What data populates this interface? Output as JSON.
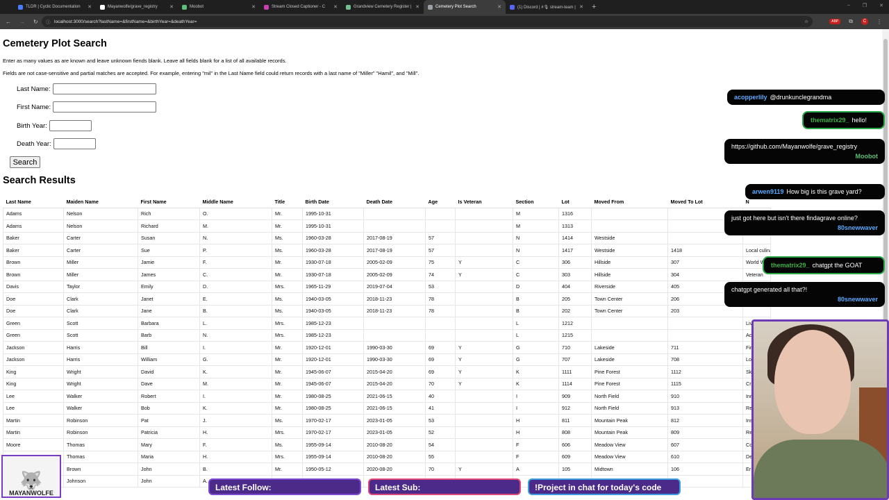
{
  "browser": {
    "tabs": [
      {
        "label": "TLDR | Cyclic Documentation",
        "color": "#4a7cff"
      },
      {
        "label": "Mayanwolfe/grave_registry",
        "color": "#ffffff"
      },
      {
        "label": "Moobot",
        "color": "#5cbf7a"
      },
      {
        "label": "Stream Closed Captioner - C",
        "color": "#c73fb0"
      },
      {
        "label": "Grandview Cemetery Register |",
        "color": "#6fbf8f"
      },
      {
        "label": "Cemetery Plot Search",
        "color": "#9aa0a6",
        "active": true
      },
      {
        "label": "(1) Discord | #🎙 stream-team |",
        "color": "#5865f2"
      }
    ],
    "new_tab": "+",
    "url": "localhost:3000/search?lastName=&firstName=&birthYear=&deathYear=",
    "ext_badge": "ABP",
    "profile_initial": "C",
    "win_controls": [
      "–",
      "❐",
      "✕"
    ]
  },
  "page": {
    "title": "Cemetery Plot Search",
    "intro1": "Enter as many values as are known and leave unknown fiends blank. Leave all fields blank for a list of all available records.",
    "intro2": "Fields are not case-sensitive and partial matches are accepted. For example, entering \"mil\" in the Last Name field could return records with a last name of \"Miller\" \"Hamil\", and \"Mill\".",
    "form": {
      "last_name_label": "Last Name:",
      "first_name_label": "First Name:",
      "birth_year_label": "Birth Year:",
      "death_year_label": "Death Year:",
      "search_label": "Search"
    },
    "results_title": "Search Results",
    "columns": [
      "Last Name",
      "Maiden Name",
      "First Name",
      "Middle Name",
      "Title",
      "Birth Date",
      "Death Date",
      "Age",
      "Is Veteran",
      "Section",
      "Lot",
      "Moved From",
      "Moved To Lot",
      "N"
    ],
    "rows": [
      [
        "Adams",
        "Nelson",
        "Rich",
        "O.",
        "Mr.",
        "1995-10-31",
        "",
        "",
        "",
        "M",
        "1316",
        "",
        "",
        ""
      ],
      [
        "Adams",
        "Nelson",
        "Richard",
        "M.",
        "Mr.",
        "1995-10-31",
        "",
        "",
        "",
        "M",
        "1313",
        "",
        "",
        ""
      ],
      [
        "Baker",
        "Carter",
        "Susan",
        "N.",
        "Ms.",
        "1960-03-28",
        "2017-08-19",
        "57",
        "",
        "N",
        "1414",
        "Westside",
        "",
        ""
      ],
      [
        "Baker",
        "Carter",
        "Sue",
        "P.",
        "Ms.",
        "1960-03-28",
        "2017-08-19",
        "57",
        "",
        "N",
        "1417",
        "Westside",
        "1418",
        "Local culinary expert"
      ],
      [
        "Brown",
        "Miller",
        "Jamie",
        "F.",
        "Mr.",
        "1930-07-18",
        "2005-02-09",
        "75",
        "Y",
        "C",
        "306",
        "Hillside",
        "307",
        "World W"
      ],
      [
        "Brown",
        "Miller",
        "James",
        "C.",
        "Mr.",
        "1930-07-18",
        "2005-02-09",
        "74",
        "Y",
        "C",
        "303",
        "Hillside",
        "304",
        "Veteran"
      ],
      [
        "Davis",
        "Taylor",
        "Emily",
        "D.",
        "Mrs.",
        "1965-11-29",
        "2019-07-04",
        "53",
        "",
        "D",
        "404",
        "Riverside",
        "405",
        ""
      ],
      [
        "Doe",
        "Clark",
        "Janet",
        "E.",
        "Ms.",
        "1940-03-05",
        "2018-11-23",
        "78",
        "",
        "B",
        "205",
        "Town Center",
        "206",
        ""
      ],
      [
        "Doe",
        "Clark",
        "Jane",
        "B.",
        "Ms.",
        "1940-03-05",
        "2018-11-23",
        "78",
        "",
        "B",
        "202",
        "Town Center",
        "203",
        ""
      ],
      [
        "Green",
        "Scott",
        "Barbara",
        "L.",
        "Mrs.",
        "1985-12-23",
        "",
        "",
        "",
        "L",
        "1212",
        "",
        "",
        "Liv"
      ],
      [
        "Green",
        "Scott",
        "Barb",
        "N.",
        "Mrs.",
        "1985-12-23",
        "",
        "",
        "",
        "L",
        "1215",
        "",
        "",
        "Ac"
      ],
      [
        "Jackson",
        "Harris",
        "Bill",
        "I.",
        "Mr.",
        "1920-12-01",
        "1990-03-30",
        "69",
        "Y",
        "G",
        "710",
        "Lakeside",
        "711",
        "Fir"
      ],
      [
        "Jackson",
        "Harris",
        "William",
        "G.",
        "Mr.",
        "1920-12-01",
        "1990-03-30",
        "69",
        "Y",
        "G",
        "707",
        "Lakeside",
        "708",
        "Lo"
      ],
      [
        "King",
        "Wright",
        "David",
        "K.",
        "Mr.",
        "1945-06-07",
        "2015-04-20",
        "69",
        "Y",
        "K",
        "1111",
        "Pine Forest",
        "1112",
        "Sk"
      ],
      [
        "King",
        "Wright",
        "Dave",
        "M.",
        "Mr.",
        "1945-06-07",
        "2015-04-20",
        "70",
        "Y",
        "K",
        "1114",
        "Pine Forest",
        "1115",
        "Cr"
      ],
      [
        "Lee",
        "Walker",
        "Robert",
        "I.",
        "Mr.",
        "1980-08-25",
        "2021-06-15",
        "40",
        "",
        "I",
        "909",
        "North Field",
        "910",
        "Inr"
      ],
      [
        "Lee",
        "Walker",
        "Bob",
        "K.",
        "Mr.",
        "1980-08-25",
        "2021-06-15",
        "41",
        "",
        "I",
        "912",
        "North Field",
        "913",
        "Re"
      ],
      [
        "Martin",
        "Robinson",
        "Pat",
        "J.",
        "Ms.",
        "1970-02-17",
        "2023-01-05",
        "53",
        "",
        "H",
        "811",
        "Mountain Peak",
        "812",
        "Ins"
      ],
      [
        "Martin",
        "Robinson",
        "Patricia",
        "H.",
        "Mrs.",
        "1970-02-17",
        "2023-01-05",
        "52",
        "",
        "H",
        "808",
        "Mountain Peak",
        "809",
        "Re"
      ],
      [
        "Moore",
        "Thomas",
        "Mary",
        "F.",
        "Ms.",
        "1955-09-14",
        "2010-08-20",
        "54",
        "",
        "F",
        "606",
        "Meadow View",
        "607",
        "Co"
      ],
      [
        "Moore",
        "Thomas",
        "Maria",
        "H.",
        "Mrs.",
        "1955-09-14",
        "2010-08-20",
        "55",
        "",
        "F",
        "609",
        "Meadow View",
        "610",
        "De"
      ],
      [
        "Smith",
        "Brown",
        "John",
        "B.",
        "Mr.",
        "1950-05-12",
        "2020-08-20",
        "70",
        "Y",
        "A",
        "105",
        "Midtown",
        "106",
        "Er"
      ],
      [
        "Smith",
        "Johnson",
        "John",
        "A.",
        "",
        "",
        "",
        "",
        "",
        "",
        "",
        "",
        "",
        ""
      ]
    ]
  },
  "chat": [
    {
      "user": "acopperlily",
      "text": "@drunkunclegrandma",
      "user_color": "#5aa9ff"
    },
    {
      "user": "thematrix29_",
      "text": "hello!",
      "user_color": "#3cb043",
      "highlight": true
    },
    {
      "text": "https://github.com/Mayanwolfe/grave_registry",
      "user": "Moobot",
      "user_color": "#5cbf7a"
    },
    {
      "user": "arwen9119",
      "text": "How big is this grave yard?",
      "user_color": "#5aa9ff"
    },
    {
      "text": "just got here but isn't there findagrave online?",
      "user": "80snewwaver",
      "user_color": "#5aa9ff"
    },
    {
      "user": "thematrix29_",
      "text": "chatgpt the GOAT",
      "user_color": "#3cb043",
      "highlight": true
    },
    {
      "text": "chatgpt generated all that?!",
      "user": "80snewwaver",
      "user_color": "#5aa9ff"
    }
  ],
  "overlay": {
    "logo_text": "MAYANWOLFE",
    "latest_follow": "Latest Follow:",
    "latest_sub": "Latest Sub:",
    "project_text": "!Project in chat for today's code"
  }
}
